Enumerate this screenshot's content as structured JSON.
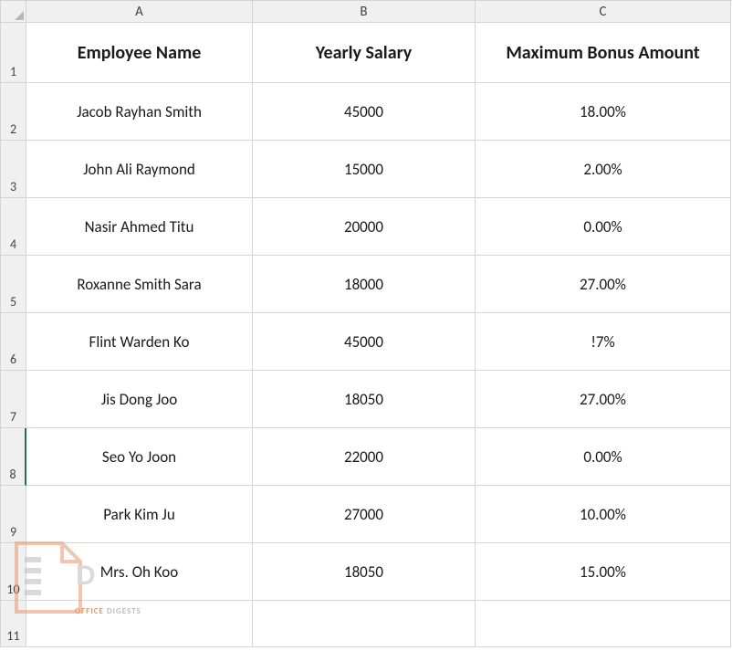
{
  "columns": [
    "A",
    "B",
    "C"
  ],
  "rowNumbers": [
    "1",
    "2",
    "3",
    "4",
    "5",
    "6",
    "7",
    "8",
    "9",
    "10",
    "11"
  ],
  "selectedRow": 8,
  "headers": {
    "col_a": "Employee Name",
    "col_b": "Yearly Salary",
    "col_c": "Maximum Bonus Amount"
  },
  "rows": [
    {
      "name": "Jacob Rayhan Smith",
      "salary": "45000",
      "bonus": "18.00%"
    },
    {
      "name": "John Ali Raymond",
      "salary": "15000",
      "bonus": "2.00%"
    },
    {
      "name": "Nasir Ahmed Titu",
      "salary": "20000",
      "bonus": "0.00%"
    },
    {
      "name": "Roxanne Smith Sara",
      "salary": "18000",
      "bonus": "27.00%"
    },
    {
      "name": "Flint Warden Ko",
      "salary": "45000",
      "bonus": "!7%"
    },
    {
      "name": "Jis Dong Joo",
      "salary": "18050",
      "bonus": "27.00%"
    },
    {
      "name": "Seo Yo Joon",
      "salary": "22000",
      "bonus": "0.00%"
    },
    {
      "name": "Park Kim Ju",
      "salary": "27000",
      "bonus": "10.00%"
    },
    {
      "name": "Mrs. Oh Koo",
      "salary": "18050",
      "bonus": "15.00%"
    }
  ],
  "watermark": {
    "letter": "D",
    "text1": "OFFICE",
    "text2": " DIGESTS"
  }
}
